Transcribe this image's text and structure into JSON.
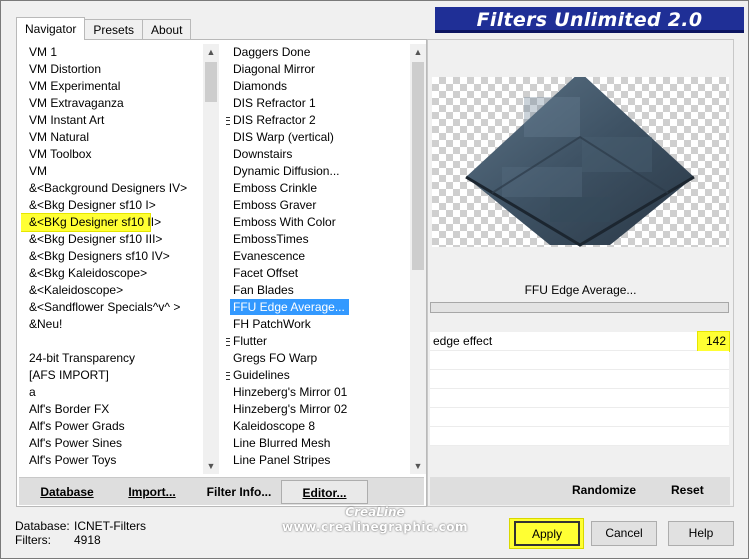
{
  "title": "Filters Unlimited 2.0",
  "tabs": {
    "navigator": "Navigator",
    "presets": "Presets",
    "about": "About"
  },
  "categories": [
    {
      "label": "VM 1"
    },
    {
      "label": "VM Distortion"
    },
    {
      "label": "VM Experimental"
    },
    {
      "label": "VM Extravaganza"
    },
    {
      "label": "VM Instant Art"
    },
    {
      "label": "VM Natural"
    },
    {
      "label": "VM Toolbox"
    },
    {
      "label": "VM"
    },
    {
      "label": "&<Background Designers IV>"
    },
    {
      "label": "&<Bkg Designer sf10 I>"
    },
    {
      "label": "&<BKg Designer sf10 II>"
    },
    {
      "label": "&<Bkg Designer sf10 III>"
    },
    {
      "label": "&<Bkg Designers sf10 IV>"
    },
    {
      "label": "&<Bkg Kaleidoscope>"
    },
    {
      "label": "&<Kaleidoscope>"
    },
    {
      "label": "&<Sandflower Specials^v^ >"
    },
    {
      "label": "&Neu!"
    },
    {
      "label": ""
    },
    {
      "label": "24-bit Transparency"
    },
    {
      "label": "[AFS IMPORT]"
    },
    {
      "label": "a"
    },
    {
      "label": "Alf's Border FX"
    },
    {
      "label": "Alf's Power Grads"
    },
    {
      "label": "Alf's Power Sines"
    },
    {
      "label": "Alf's Power Toys"
    }
  ],
  "filters": [
    {
      "label": "Daggers Done",
      "marked": false
    },
    {
      "label": "Diagonal Mirror",
      "marked": false
    },
    {
      "label": "Diamonds",
      "marked": false
    },
    {
      "label": "DIS Refractor 1",
      "marked": false
    },
    {
      "label": "DIS Refractor 2",
      "marked": true
    },
    {
      "label": "DIS Warp (vertical)",
      "marked": false
    },
    {
      "label": "Downstairs",
      "marked": false
    },
    {
      "label": "Dynamic Diffusion...",
      "marked": false
    },
    {
      "label": "Emboss Crinkle",
      "marked": false
    },
    {
      "label": "Emboss Graver",
      "marked": false
    },
    {
      "label": "Emboss With Color",
      "marked": false
    },
    {
      "label": "EmbossTimes",
      "marked": false
    },
    {
      "label": "Evanescence",
      "marked": false
    },
    {
      "label": "Facet Offset",
      "marked": false
    },
    {
      "label": "Fan Blades",
      "marked": false
    },
    {
      "label": "FFU Edge Average...",
      "marked": false
    },
    {
      "label": "FH PatchWork",
      "marked": false
    },
    {
      "label": "Flutter",
      "marked": true
    },
    {
      "label": "Gregs FO Warp",
      "marked": false
    },
    {
      "label": "Guidelines",
      "marked": true
    },
    {
      "label": "Hinzeberg's Mirror 01",
      "marked": false
    },
    {
      "label": "Hinzeberg's Mirror 02",
      "marked": false
    },
    {
      "label": "Kaleidoscope 8",
      "marked": false
    },
    {
      "label": "Line Blurred Mesh",
      "marked": false
    },
    {
      "label": "Line Panel Stripes",
      "marked": false
    }
  ],
  "buttons": {
    "database": "Database",
    "import": "Import...",
    "filter_info": "Filter Info...",
    "editor": "Editor...",
    "randomize": "Randomize",
    "reset": "Reset",
    "apply": "Apply",
    "cancel": "Cancel",
    "help": "Help"
  },
  "filter_name": "FFU Edge Average...",
  "param": {
    "name": "edge effect",
    "value": "142"
  },
  "info": {
    "database_label": "Database:",
    "database_value": "ICNET-Filters",
    "filters_label": "Filters:",
    "filters_value": "4918"
  },
  "watermark": {
    "line1": "CreaLine",
    "line2": "www.crealinegraphic.com"
  },
  "colors": {
    "highlight": "#ffff33",
    "selection": "#3399ff",
    "title_banner": "#1f2f96"
  }
}
